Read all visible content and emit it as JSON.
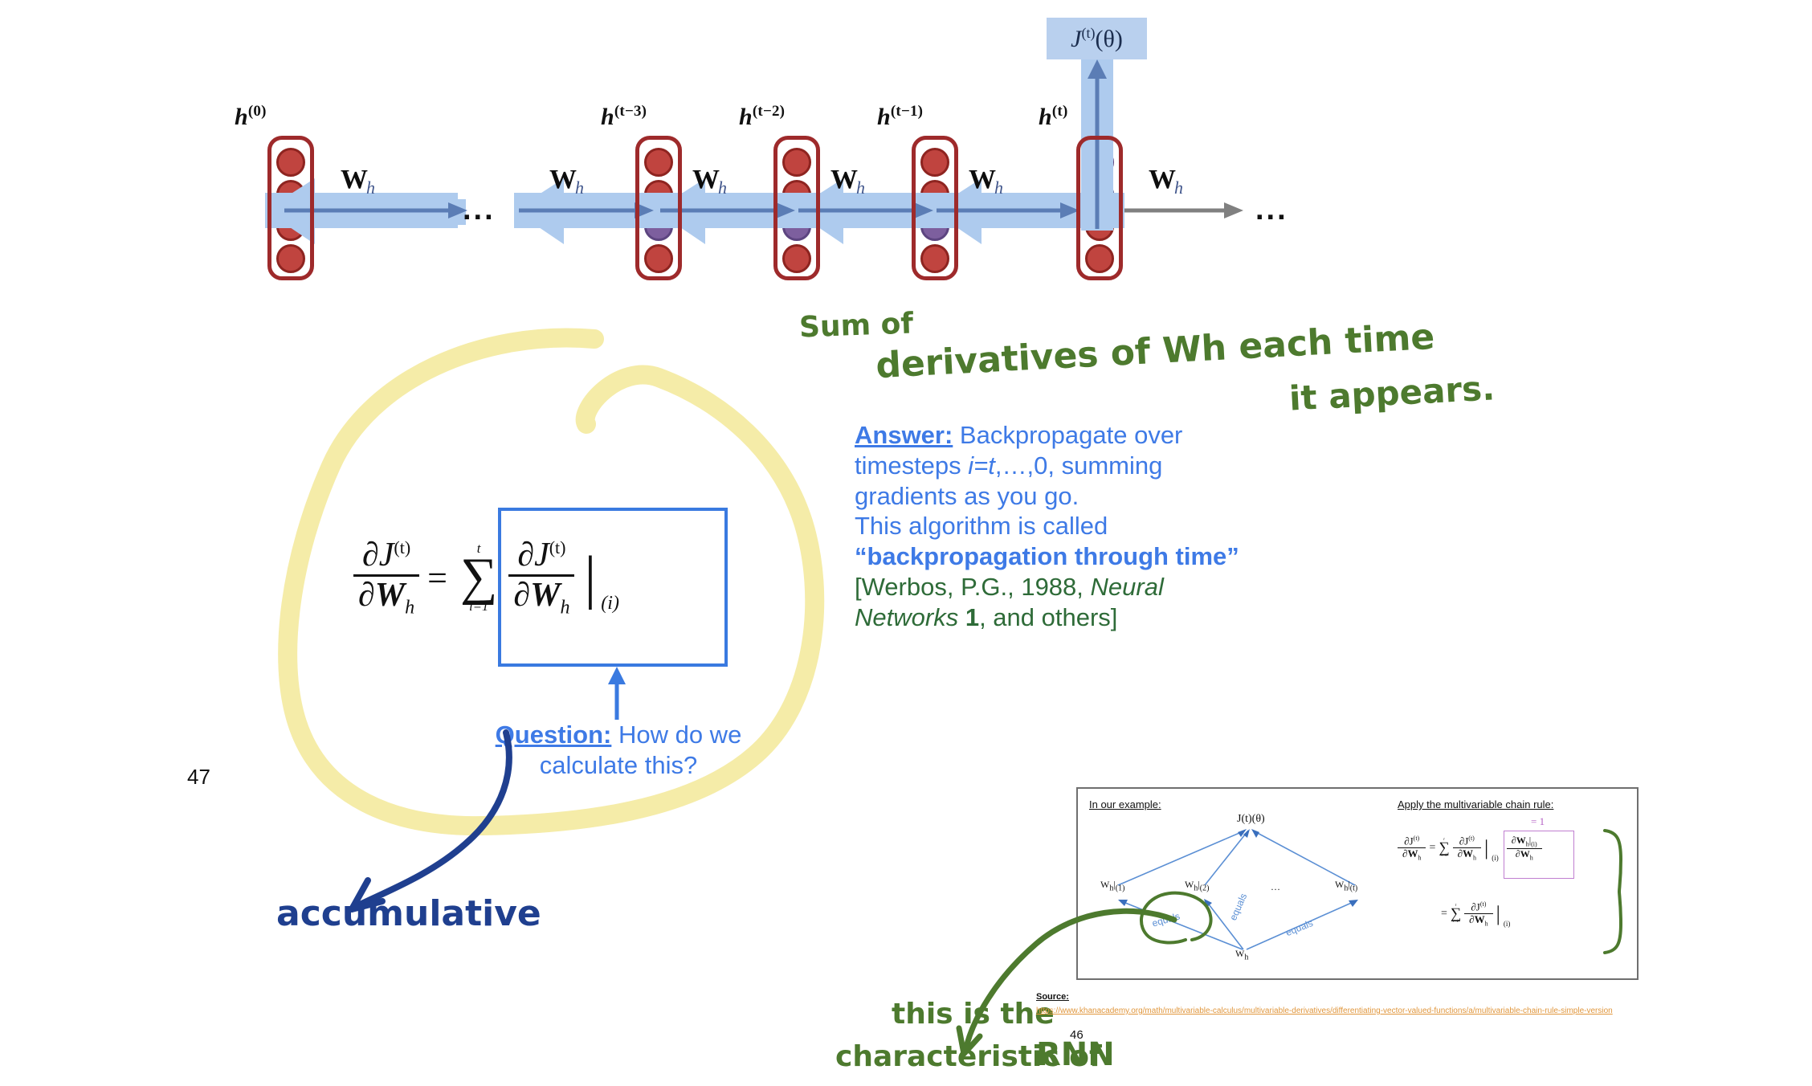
{
  "page": {
    "number": "47",
    "background": "#ffffff"
  },
  "colors": {
    "cell_border": "#9e2a2b",
    "neuron_red": "#c0443f",
    "neuron_violet": "#7d5f9e",
    "arrow_blue": "#aecbee",
    "arrow_stroke": "#5b7db5",
    "eq_box_border": "#3a7ae0",
    "text_blue": "#3e7ae6",
    "text_green": "#2e6b38",
    "highlight_yellow": "#f5ecae",
    "ink_green": "#4d7a2e",
    "ink_blue": "#1f3f8f",
    "link_orange": "#e0963c"
  },
  "rnn_diagram": {
    "hidden_state_labels": [
      "h(0)",
      "h(t−3)",
      "h(t−2)",
      "h(t−1)",
      "h(t)"
    ],
    "hidden_state_bases": [
      "h",
      "h",
      "h",
      "h",
      "h"
    ],
    "hidden_state_sups": [
      "(0)",
      "(t−3)",
      "(t−2)",
      "(t−1)",
      "(t)"
    ],
    "weight_label_base": "W",
    "weight_label_sub": "h",
    "weight_labels_count": 6,
    "loss_box_label": "J(t)(θ)",
    "loss_box_base": "J",
    "loss_box_sup": "(t)",
    "loss_box_arg": "(θ)",
    "ellipsis_left": "...",
    "ellipsis_right": "..."
  },
  "equation": {
    "lhs_num": "∂J",
    "lhs_num_sup": "(t)",
    "lhs_den": "∂W",
    "lhs_den_sub": "h",
    "equals": "=",
    "sum_upper": "t",
    "sum_symbol": "∑",
    "sum_lower": "i=1",
    "rhs_num": "∂J",
    "rhs_num_sup": "(t)",
    "rhs_den": "∂W",
    "rhs_den_sub": "h",
    "eval_bar": "|",
    "eval_sub": "(i)"
  },
  "question": {
    "label": "Question:",
    "line1": " How do we",
    "line2": "calculate this?"
  },
  "answer": {
    "label": "Answer:",
    "line1": " Backpropagate over",
    "line2_a": "timesteps ",
    "line2_i": "i=t",
    "line2_b": ",…,0, summing",
    "line3": "gradients as you go.",
    "line4": "This algorithm is called",
    "line5_bold": "“backpropagation through time”",
    "cite_line1_a": "[Werbos, P.G., 1988, ",
    "cite_line1_i": "Neural",
    "cite_line2_i": "Networks",
    "cite_line2_b": " 1",
    "cite_line2_c": ", and others]"
  },
  "handwriting": {
    "note_top_1": "Sum of",
    "note_top_2": "derivatives of Wh  each time",
    "note_top_3": "it appears.",
    "note_accumulative": "accumulative",
    "note_bottom_1": "this is the",
    "note_bottom_2": "characteristic of",
    "note_bottom_3": "RNN"
  },
  "slide46": {
    "page_number": "46",
    "left_title": "In our example:",
    "right_title": "Apply the multivariable chain rule:",
    "loss_node": "J(t)(θ)",
    "node_w1": "Wh|(1)",
    "node_w2": "Wh|(2)",
    "node_dots": "…",
    "node_wt": "Wh|(t)",
    "node_root": "Wh",
    "edge_labels": [
      "equals",
      "equals",
      "equals"
    ],
    "equals_one": "= 1",
    "eq_line1": "∂J(t)/∂Wh = Σ(i=1..t) ∂J(t)/∂Wh|(i) · ∂Wh|(i)/∂Wh",
    "eq_line2": "= Σ(i=1..t) ∂J(t)/∂Wh|(i)",
    "source_label": "Source:",
    "source_url": "https://www.khanacademy.org/math/multivariable-calculus/multivariable-derivatives/differentiating-vector-valued-functions/a/multivariable-chain-rule-simple-version"
  }
}
